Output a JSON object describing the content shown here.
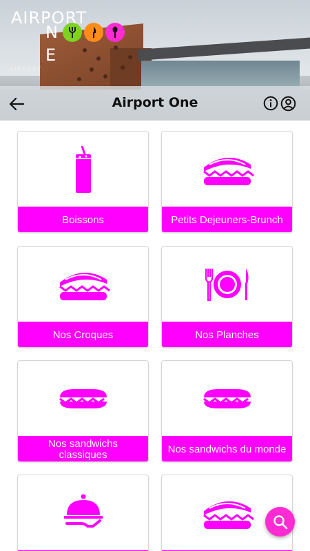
{
  "header": {
    "title": "Airport One",
    "logo_line1": "AIRPORT",
    "logo_letter_n": "N",
    "logo_letter_e": "E",
    "mini_logo": "AIRPORT",
    "back_icon": "arrow-back-icon",
    "info_icon": "info-icon",
    "account_icon": "account-circle-icon"
  },
  "colors": {
    "accent": "#ff00ff",
    "fab": "#ff2bd2",
    "logo_green": "#7ed321",
    "logo_orange": "#ff8c1a",
    "logo_magenta": "#ff2bd2"
  },
  "categories": [
    {
      "label": "Boissons",
      "icon": "drink-glass-icon"
    },
    {
      "label": "Petits Dejeuners-Brunch",
      "icon": "sandwich-icon"
    },
    {
      "label": "Nos Croques",
      "icon": "sandwich-icon"
    },
    {
      "label": "Nos Planches",
      "icon": "plate-cutlery-icon"
    },
    {
      "label": "Nos sandwichs classiques",
      "icon": "baguette-icon"
    },
    {
      "label": "Nos sandwichs du monde",
      "icon": "baguette-icon"
    },
    {
      "label": "",
      "icon": "cloche-serving-icon"
    },
    {
      "label": "",
      "icon": "sandwich-icon"
    }
  ],
  "fab": {
    "icon": "search-icon"
  }
}
